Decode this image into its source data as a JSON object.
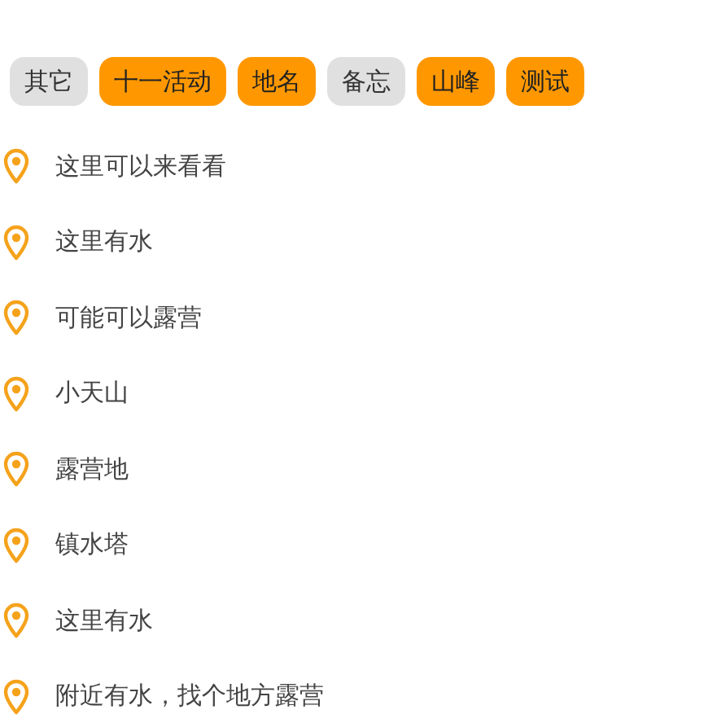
{
  "tags": [
    {
      "label": "其它",
      "selected": false
    },
    {
      "label": "十一活动",
      "selected": true
    },
    {
      "label": "地名",
      "selected": true
    },
    {
      "label": "备忘",
      "selected": false
    },
    {
      "label": "山峰",
      "selected": true
    },
    {
      "label": "测试",
      "selected": true
    }
  ],
  "places": [
    {
      "name": "这里可以来看看"
    },
    {
      "name": "这里有水"
    },
    {
      "name": "可能可以露营"
    },
    {
      "name": "小天山"
    },
    {
      "name": "露营地"
    },
    {
      "name": "镇水塔"
    },
    {
      "name": "这里有水"
    },
    {
      "name": "附近有水，找个地方露营"
    }
  ]
}
